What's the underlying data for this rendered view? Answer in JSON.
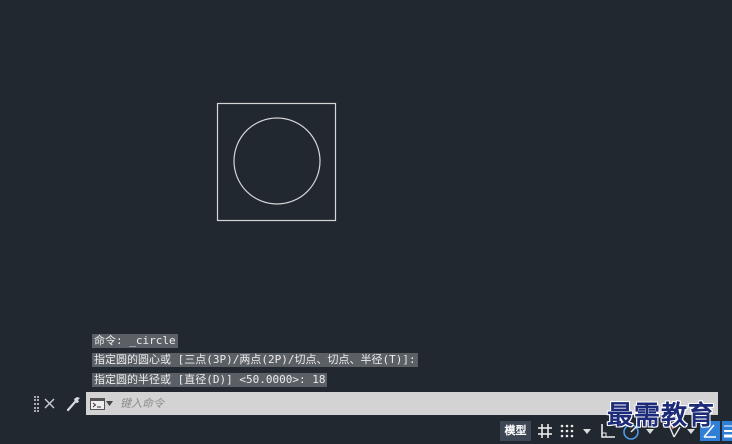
{
  "colors": {
    "canvas_background": "#212830",
    "geometry_stroke": "#d6d6d6",
    "history_highlight": "#5b6067",
    "command_bar_background": "#d3d3d3",
    "status_accent_blue": "#2f7fd6",
    "watermark_color": "#1d2b78"
  },
  "command_history": {
    "lines": [
      "命令: _circle",
      "指定圆的圆心或 [三点(3P)/两点(2P)/切点、切点、半径(T)]:",
      "指定圆的半径或 [直径(D)] <50.0000>: 18"
    ]
  },
  "command_line": {
    "placeholder": "键入命令",
    "icons": {
      "grip": "grip-handle-icon",
      "close": "close-icon",
      "customize": "wrench-icon",
      "recent_commands": "command-prompt-icon",
      "dropdown": "chevron-down-icon"
    }
  },
  "status_bar": {
    "model_tab": "模型",
    "icons": [
      "grid-icon",
      "snap-icon",
      "chevron-down-icon",
      "ortho-icon",
      "polar-tracking-icon",
      "chevron-down-icon",
      "isometric-icon",
      "chevron-down-icon",
      "dynamic-input-icon",
      "lineweight-icon"
    ]
  },
  "watermark": {
    "text": "最需教育"
  }
}
